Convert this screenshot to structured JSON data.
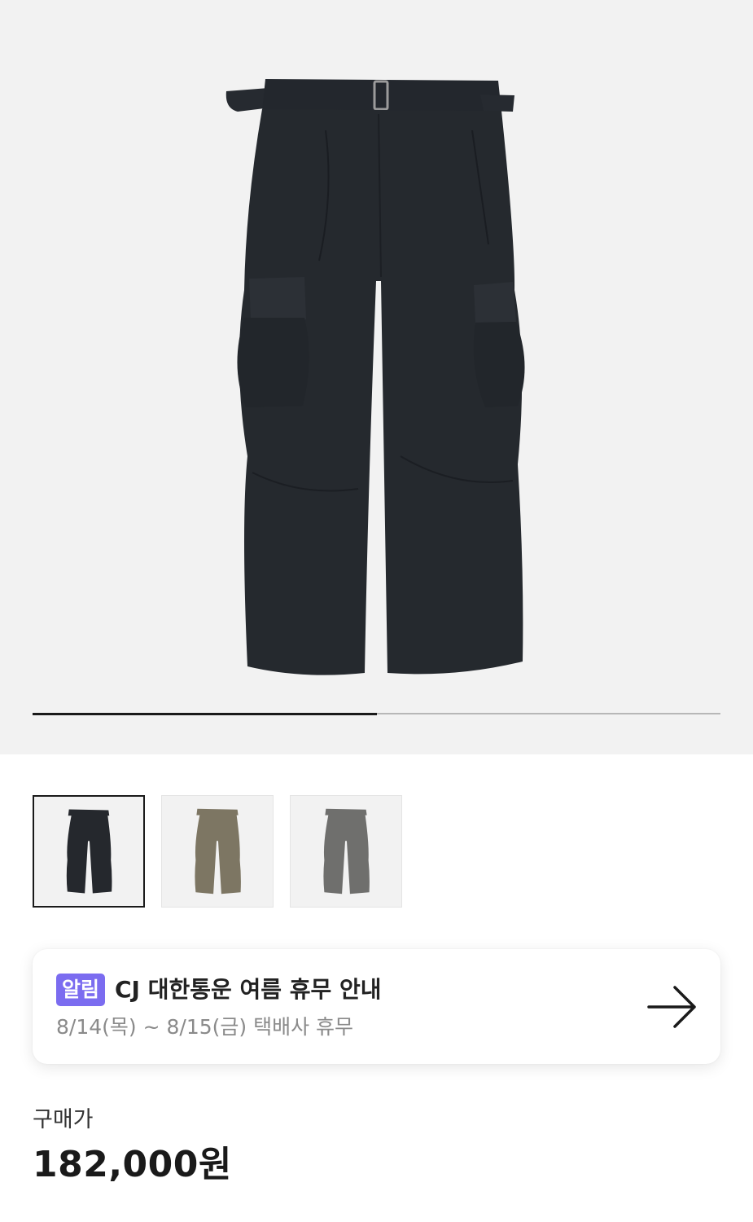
{
  "gallery": {
    "progress_fraction": 0.5,
    "thumbnails": [
      {
        "color": "#25282d",
        "selected": true
      },
      {
        "color": "#7d7663",
        "selected": false
      },
      {
        "color": "#6f6f6d",
        "selected": false
      }
    ]
  },
  "notice": {
    "badge": "알림",
    "title": "CJ 대한통운 여름 휴무 안내",
    "subtitle": "8/14(목) ~ 8/15(금) 택배사 휴무",
    "arrow_icon": "arrow-right-icon",
    "badge_color": "#7b6cf0"
  },
  "price": {
    "label": "구매가",
    "value": "182,000원"
  }
}
